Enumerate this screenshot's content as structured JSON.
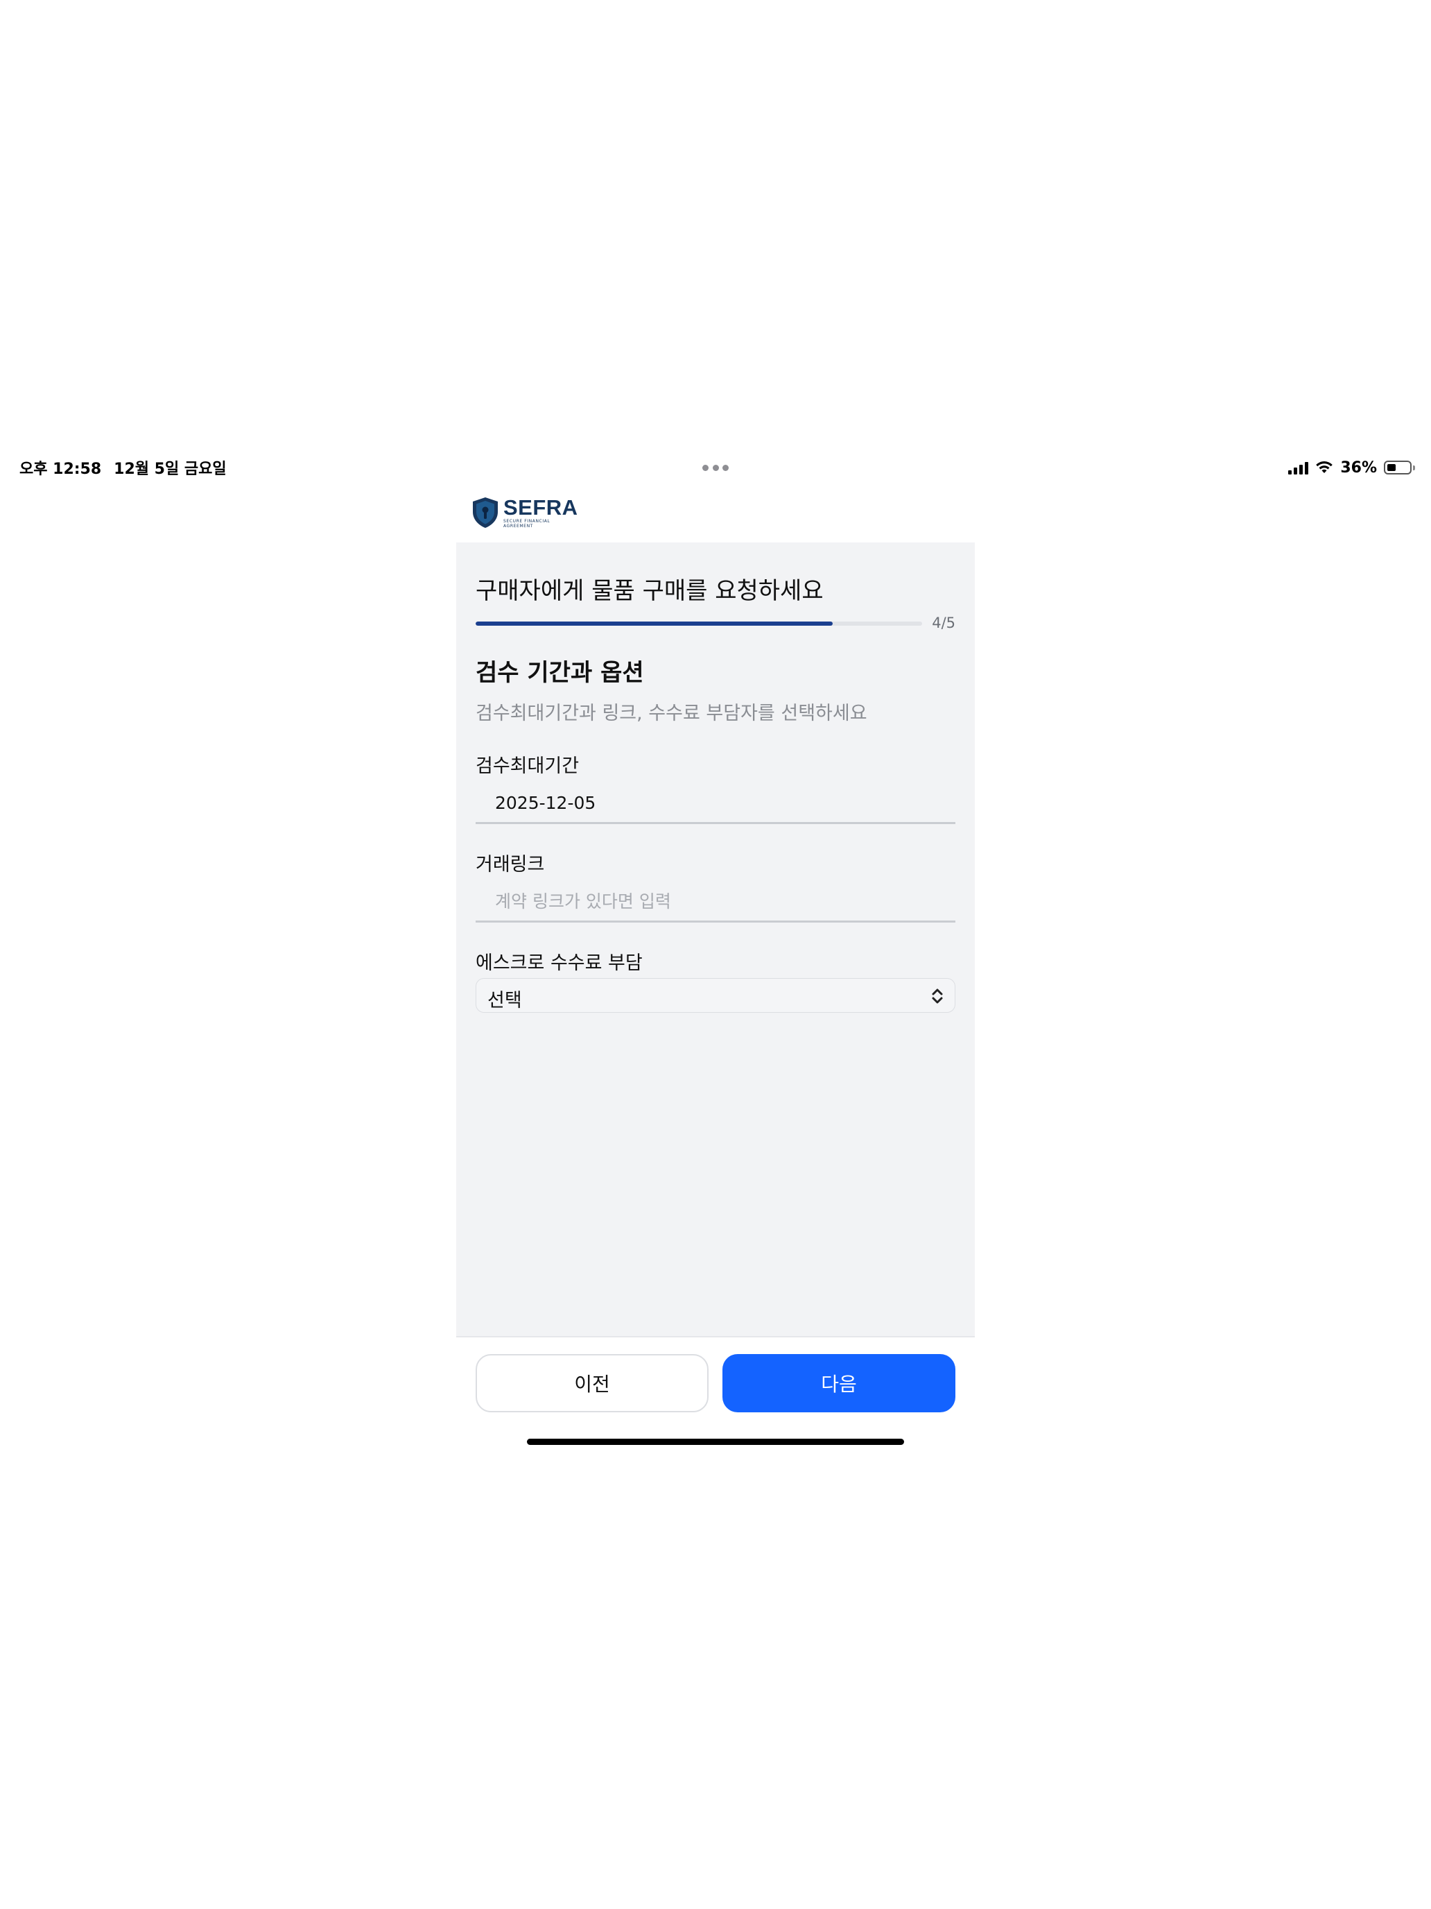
{
  "status_bar": {
    "time": "오후 12:58",
    "date": "12월 5일 금요일",
    "battery": "36%",
    "battery_level": 0.36
  },
  "header": {
    "logo_text": "SEFRA",
    "logo_tagline": "SECURE FINANCIAL AGREEMENT"
  },
  "form": {
    "page_title": "구매자에게 물품 구매를 요청하세요",
    "progress": {
      "current": 4,
      "total": 5,
      "label": "4/5",
      "fraction": 0.8
    },
    "section_title": "검수 기간과 옵션",
    "section_subtitle": "검수최대기간과 링크, 수수료 부담자를 선택하세요",
    "inspection_period": {
      "label": "검수최대기간",
      "value": "2025-12-05"
    },
    "trade_link": {
      "label": "거래링크",
      "value": "",
      "placeholder": "계약 링크가 있다면 입력"
    },
    "escrow_fee": {
      "label": "에스크로 수수료 부담",
      "selected": "선택"
    }
  },
  "footer": {
    "prev_label": "이전",
    "next_label": "다음"
  },
  "colors": {
    "progress": "#1b3f8f",
    "primary_button": "#1463ff",
    "panel_background": "#f2f3f5",
    "logo": "#17375e"
  }
}
